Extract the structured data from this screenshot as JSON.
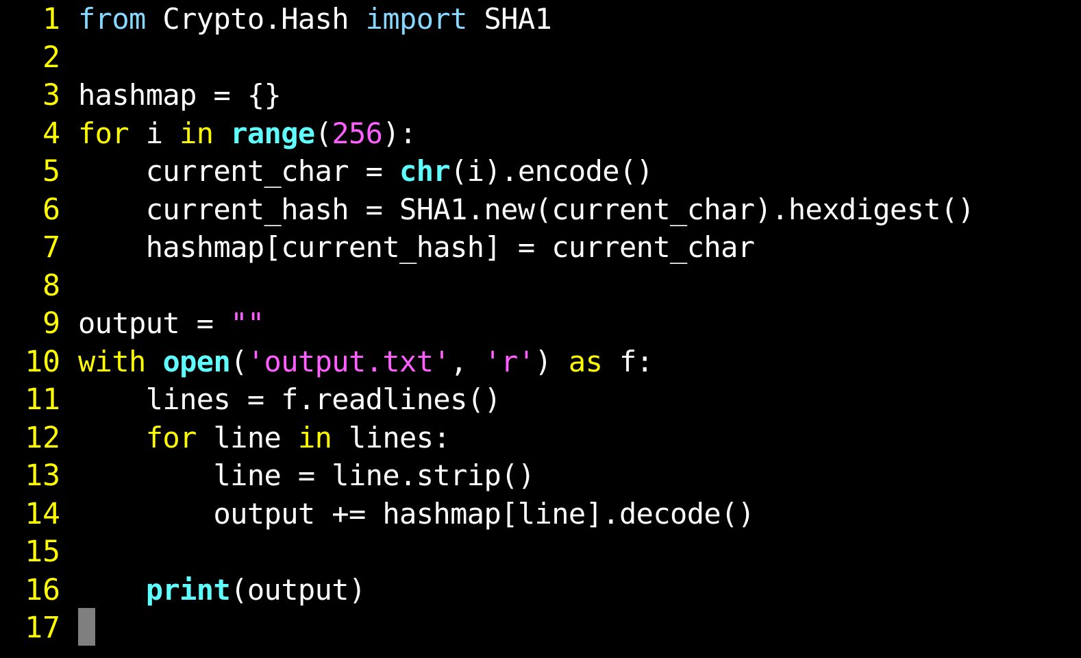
{
  "editor": {
    "colors": {
      "background": "#000000",
      "line_number": "#ffff00",
      "plain": "#ffffff",
      "keyword": "#ffff00",
      "import_keyword": "#87d7ff",
      "builtin": "#5fffff",
      "number": "#ff5fff",
      "string": "#ff5fff",
      "cursor": "#7f7f7f"
    },
    "lines": [
      {
        "num": "1",
        "tokens": [
          {
            "t": "from",
            "k": "imp"
          },
          {
            "t": " Crypto.Hash ",
            "k": "plain"
          },
          {
            "t": "import",
            "k": "imp"
          },
          {
            "t": " SHA1",
            "k": "plain"
          }
        ]
      },
      {
        "num": "2",
        "tokens": []
      },
      {
        "num": "3",
        "tokens": [
          {
            "t": "hashmap = {}",
            "k": "plain"
          }
        ]
      },
      {
        "num": "4",
        "tokens": [
          {
            "t": "for",
            "k": "kw"
          },
          {
            "t": " i ",
            "k": "plain"
          },
          {
            "t": "in",
            "k": "kw"
          },
          {
            "t": " ",
            "k": "plain"
          },
          {
            "t": "range",
            "k": "fn"
          },
          {
            "t": "(",
            "k": "plain"
          },
          {
            "t": "256",
            "k": "num"
          },
          {
            "t": "):",
            "k": "plain"
          }
        ]
      },
      {
        "num": "5",
        "tokens": [
          {
            "t": "    current_char = ",
            "k": "plain"
          },
          {
            "t": "chr",
            "k": "fn"
          },
          {
            "t": "(i).encode()",
            "k": "plain"
          }
        ]
      },
      {
        "num": "6",
        "tokens": [
          {
            "t": "    current_hash = SHA1.new(current_char).hexdigest()",
            "k": "plain"
          }
        ]
      },
      {
        "num": "7",
        "tokens": [
          {
            "t": "    hashmap[current_hash] = current_char",
            "k": "plain"
          }
        ]
      },
      {
        "num": "8",
        "tokens": []
      },
      {
        "num": "9",
        "tokens": [
          {
            "t": "output = ",
            "k": "plain"
          },
          {
            "t": "\"\"",
            "k": "str"
          }
        ]
      },
      {
        "num": "10",
        "tokens": [
          {
            "t": "with",
            "k": "kw"
          },
          {
            "t": " ",
            "k": "plain"
          },
          {
            "t": "open",
            "k": "fn"
          },
          {
            "t": "(",
            "k": "plain"
          },
          {
            "t": "'output.txt'",
            "k": "str"
          },
          {
            "t": ", ",
            "k": "plain"
          },
          {
            "t": "'r'",
            "k": "str"
          },
          {
            "t": ") ",
            "k": "plain"
          },
          {
            "t": "as",
            "k": "kw"
          },
          {
            "t": " f:",
            "k": "plain"
          }
        ]
      },
      {
        "num": "11",
        "tokens": [
          {
            "t": "    lines = f.readlines()",
            "k": "plain"
          }
        ]
      },
      {
        "num": "12",
        "tokens": [
          {
            "t": "    ",
            "k": "plain"
          },
          {
            "t": "for",
            "k": "kw"
          },
          {
            "t": " line ",
            "k": "plain"
          },
          {
            "t": "in",
            "k": "kw"
          },
          {
            "t": " lines:",
            "k": "plain"
          }
        ]
      },
      {
        "num": "13",
        "tokens": [
          {
            "t": "        line = line.strip()",
            "k": "plain"
          }
        ]
      },
      {
        "num": "14",
        "tokens": [
          {
            "t": "        output += hashmap[line].decode()",
            "k": "plain"
          }
        ]
      },
      {
        "num": "15",
        "tokens": []
      },
      {
        "num": "16",
        "tokens": [
          {
            "t": "    ",
            "k": "plain"
          },
          {
            "t": "print",
            "k": "fn"
          },
          {
            "t": "(output)",
            "k": "plain"
          }
        ]
      },
      {
        "num": "17",
        "tokens": []
      }
    ]
  }
}
